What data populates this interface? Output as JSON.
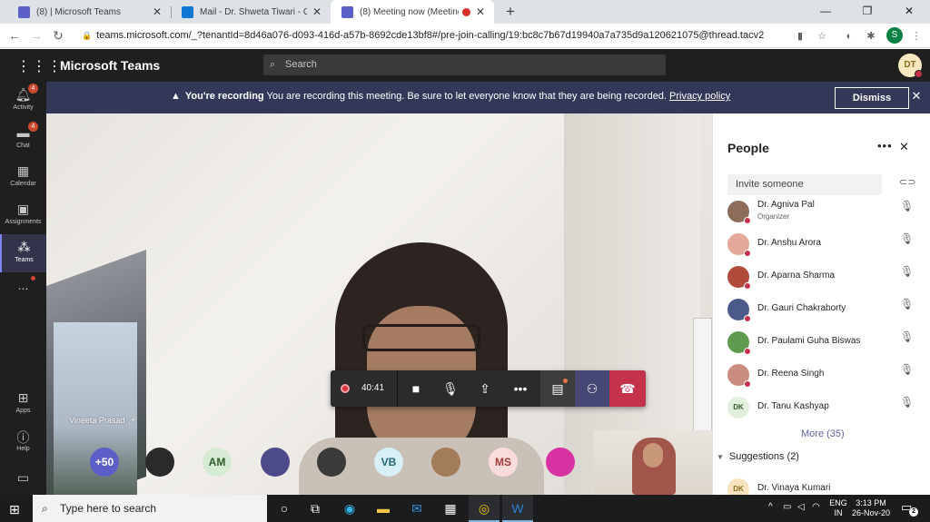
{
  "browser": {
    "tabs": [
      {
        "title": "(8) | Microsoft Teams",
        "icon": "teams-icon",
        "icon_color": "#5b5fc7"
      },
      {
        "title": "Mail - Dr. Shweta Tiwari - Outloo",
        "icon": "outlook-icon",
        "icon_color": "#0f78d4"
      },
      {
        "title": "(8) Meeting now (Meeting) | ",
        "icon": "teams-icon",
        "icon_color": "#5b5fc7",
        "active": true
      }
    ],
    "new_tab_label": "+",
    "url": "teams.microsoft.com/_?tenantId=8d46a076-d093-416d-a57b-8692cde13bf8#/pre-join-calling/19:bc8c7b67d19940a7a735d9a120621075@thread.tacv2",
    "profile_initial": "S"
  },
  "teams": {
    "app_title": "Microsoft Teams",
    "search_placeholder": "Search",
    "user_initials": "DT",
    "accent": "#6264a7"
  },
  "rail": [
    {
      "label": "Activity",
      "icon": "bell-icon",
      "badge": "4"
    },
    {
      "label": "Chat",
      "icon": "chat-icon",
      "badge": "4"
    },
    {
      "label": "Calendar",
      "icon": "calendar-icon"
    },
    {
      "label": "Assignments",
      "icon": "assignments-icon"
    },
    {
      "label": "Teams",
      "icon": "teams-icon",
      "active": true
    },
    {
      "label": "...",
      "icon": "more-icon"
    },
    {
      "label": "Apps",
      "icon": "apps-icon"
    },
    {
      "label": "Help",
      "icon": "help-icon"
    }
  ],
  "banner": {
    "bold": "You're recording",
    "text": "You are recording this meeting. Be sure to let everyone know that they are being recorded.",
    "link": "Privacy policy",
    "dismiss": "Dismiss"
  },
  "stage": {
    "speaker_name": "Vineeta Prasad"
  },
  "controls": {
    "timer": "40:41",
    "recording_color": "#e0303a",
    "hangup_color": "#c4314b"
  },
  "strip": [
    {
      "label": "+50",
      "bg": "#5b5fc7",
      "fg": "#ffffff"
    },
    {
      "label": "",
      "bg": "#2a2a2a",
      "fg": "#ffffff"
    },
    {
      "label": "AM",
      "bg": "#d7ebd4",
      "fg": "#2e5f2b"
    },
    {
      "label": "",
      "bg": "#4d4a8a",
      "fg": "#ffffff"
    },
    {
      "label": "",
      "bg": "#3a3a3a",
      "fg": "#ffffff"
    },
    {
      "label": "VB",
      "bg": "#d6f0f5",
      "fg": "#1f6676"
    },
    {
      "label": "",
      "bg": "#a37c5a",
      "fg": "#ffffff"
    },
    {
      "label": "MS",
      "bg": "#fbdcdc",
      "fg": "#a33a3a"
    },
    {
      "label": "",
      "bg": "#d832a2",
      "fg": "#ffffff"
    }
  ],
  "people": {
    "title": "People",
    "invite_placeholder": "Invite someone",
    "participants": [
      {
        "name": "Dr. Agniva Pal",
        "role": "Organizer",
        "avatar_bg": "#8b6d5a"
      },
      {
        "name": "Dr. Anshu Arora",
        "avatar_bg": "#e3a99a"
      },
      {
        "name": "Dr. Aparna Sharma",
        "avatar_bg": "#b04a3b"
      },
      {
        "name": "Dr. Gauri Chakraborty",
        "avatar_bg": "#4b5a8a"
      },
      {
        "name": "Dr. Paulami Guha Biswas",
        "avatar_bg": "#5f9a4e"
      },
      {
        "name": "Dr. Reena Singh",
        "avatar_bg": "#c98c7e"
      },
      {
        "name": "Dr. Tanu Kashyap",
        "initials": "DK",
        "avatar_bg": "#e1efdc"
      }
    ],
    "more": "More (35)",
    "suggestions": "Suggestions",
    "suggestions_count": "(2)",
    "suggested": [
      {
        "name": "Dr. Vinaya Kumari",
        "initials": "DK",
        "avatar_bg": "#f8e3c1"
      }
    ]
  },
  "taskbar": {
    "search_placeholder": "Type here to search",
    "lang_top": "ENG",
    "lang_bottom": "IN",
    "time": "3:13 PM",
    "date": "26-Nov-20",
    "notif_count": "2"
  }
}
